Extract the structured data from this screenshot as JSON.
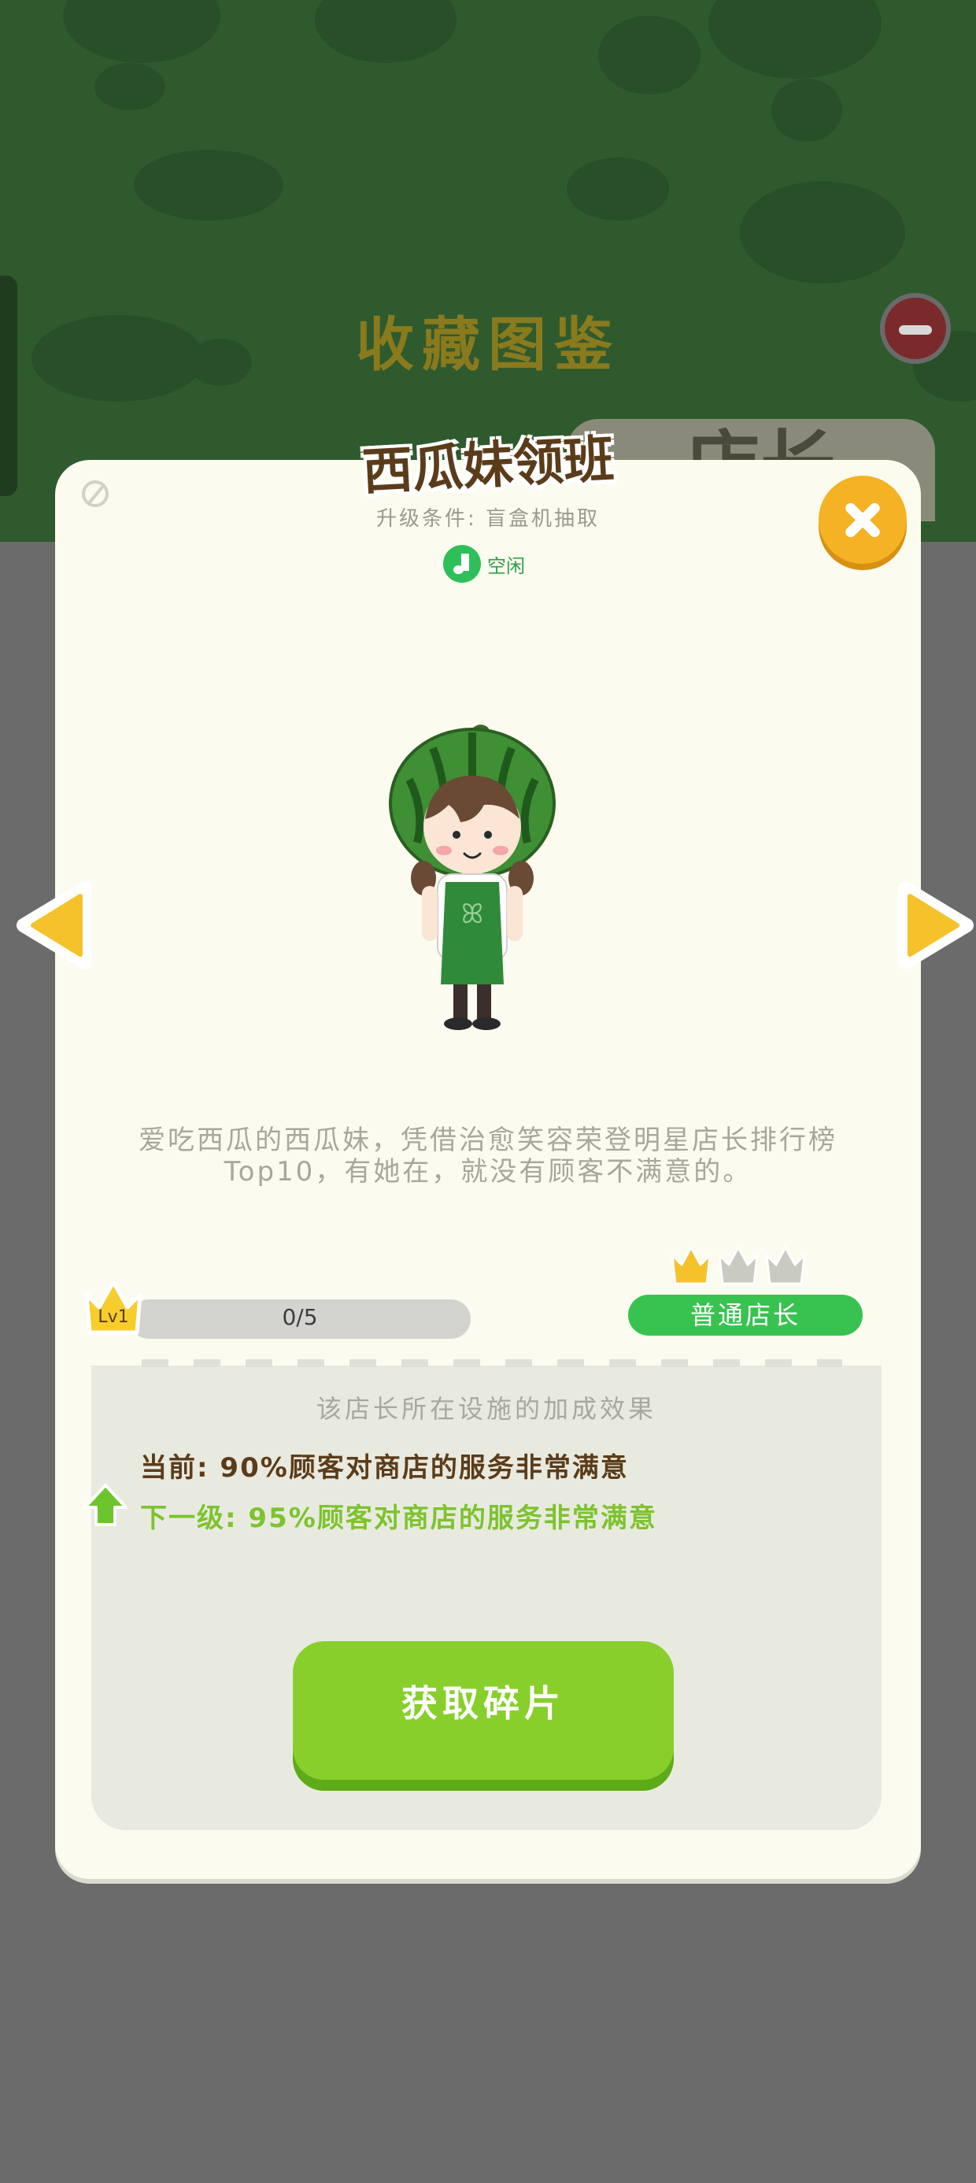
{
  "background": {
    "title": "收藏图鉴",
    "tab_label": "店长"
  },
  "card": {
    "title": "西瓜妹领班",
    "upgrade_condition": "升级条件: 盲盒机抽取",
    "status_icon": "music-note-icon",
    "status": "空闲",
    "description": "爱吃西瓜的西瓜妹，凭借治愈笑容荣登明星店长排行榜Top10，有她在，就没有顾客不满意的。"
  },
  "level": {
    "badge": "Lv1",
    "progress_text": "0/5",
    "progress_fraction": 0,
    "crowns_total": 3,
    "crowns_filled": 1,
    "rank": "普通店长"
  },
  "effects": {
    "title": "该店长所在设施的加成效果",
    "current": "当前: 90%顾客对商店的服务非常满意",
    "next": "下一级: 95%顾客对商店的服务非常满意"
  },
  "action": {
    "get_fragments": "获取碎片"
  },
  "colors": {
    "accent_green": "#88cf2c",
    "status_green": "#2fbf5a",
    "gold": "#f5b224",
    "title_brown": "#5b3c1a"
  }
}
